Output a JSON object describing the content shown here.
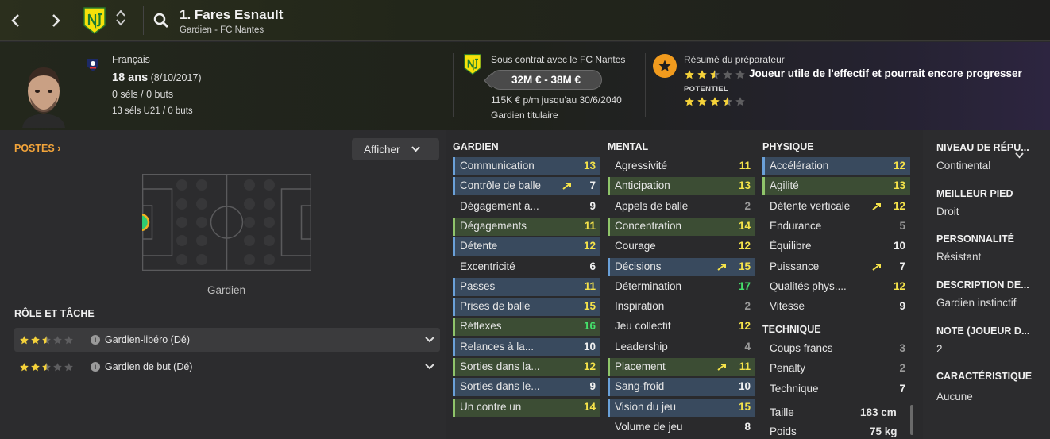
{
  "header": {
    "back_icon": "chevron-left-icon",
    "forward_icon": "chevron-right-icon",
    "player_name": "1. Fares Esnault",
    "subtitle": "Gardien - FC Nantes",
    "club_crest_color": "#f6e10a"
  },
  "info": {
    "nationality": "Français",
    "age": "18 ans",
    "birthdate": "(8/10/2017)",
    "caps": "0 séls / 0 buts",
    "caps_u21": "13 séls U21 / 0 buts",
    "contract_line": "Sous contrat avec le FC Nantes",
    "value_range": "32M € - 38M €",
    "wage": "115K € p/m jusqu'au 30/6/2040",
    "squad_status": "Gardien titulaire",
    "coach_title": "Résumé du préparateur",
    "coach_summary": "Joueur utile de l'effectif et pourrait encore progresser",
    "potential_label": "POTENTIEL",
    "current_stars": 2.5,
    "potential_stars": 3.5
  },
  "left": {
    "postes_label": "POSTES",
    "afficher_label": "Afficher",
    "position_caption": "Gardien",
    "role_title": "RÔLE ET TÂCHE",
    "roles": [
      {
        "stars": 2.5,
        "label": "Gardien-libéro (Dé)"
      },
      {
        "stars": 2.5,
        "label": "Gardien de but (Dé)"
      }
    ]
  },
  "attributes": {
    "gardien_title": "GARDIEN",
    "mental_title": "MENTAL",
    "physique_title": "PHYSIQUE",
    "technique_title": "TECHNIQUE",
    "gardien": [
      {
        "name": "Communication",
        "value": "13",
        "hl": "blue",
        "color": "y"
      },
      {
        "name": "Contrôle de balle",
        "value": "7",
        "hl": "blue",
        "color": "w",
        "arrow": true
      },
      {
        "name": "Dégagement a...",
        "value": "9",
        "hl": "",
        "color": "w"
      },
      {
        "name": "Dégagements",
        "value": "11",
        "hl": "green",
        "color": "y"
      },
      {
        "name": "Détente",
        "value": "12",
        "hl": "blue",
        "color": "y"
      },
      {
        "name": "Excentricité",
        "value": "6",
        "hl": "",
        "color": "w"
      },
      {
        "name": "Passes",
        "value": "11",
        "hl": "blue",
        "color": "y"
      },
      {
        "name": "Prises de balle",
        "value": "15",
        "hl": "blue",
        "color": "y"
      },
      {
        "name": "Réflexes",
        "value": "16",
        "hl": "green",
        "color": "g"
      },
      {
        "name": "Relances à la...",
        "value": "10",
        "hl": "blue",
        "color": "w"
      },
      {
        "name": "Sorties dans la...",
        "value": "12",
        "hl": "green",
        "color": "y"
      },
      {
        "name": "Sorties dans le...",
        "value": "9",
        "hl": "blue",
        "color": "w"
      },
      {
        "name": "Un contre un",
        "value": "14",
        "hl": "green",
        "color": "y"
      }
    ],
    "mental": [
      {
        "name": "Agressivité",
        "value": "11",
        "hl": "",
        "color": "y"
      },
      {
        "name": "Anticipation",
        "value": "13",
        "hl": "green",
        "color": "y"
      },
      {
        "name": "Appels de balle",
        "value": "2",
        "hl": "",
        "color": "gr"
      },
      {
        "name": "Concentration",
        "value": "14",
        "hl": "green",
        "color": "y"
      },
      {
        "name": "Courage",
        "value": "12",
        "hl": "",
        "color": "y"
      },
      {
        "name": "Décisions",
        "value": "15",
        "hl": "blue",
        "color": "y",
        "arrow": true
      },
      {
        "name": "Détermination",
        "value": "17",
        "hl": "",
        "color": "g"
      },
      {
        "name": "Inspiration",
        "value": "2",
        "hl": "",
        "color": "gr"
      },
      {
        "name": "Jeu collectif",
        "value": "12",
        "hl": "",
        "color": "y"
      },
      {
        "name": "Leadership",
        "value": "4",
        "hl": "",
        "color": "gr"
      },
      {
        "name": "Placement",
        "value": "11",
        "hl": "green",
        "color": "y",
        "arrow": true
      },
      {
        "name": "Sang-froid",
        "value": "10",
        "hl": "blue",
        "color": "w"
      },
      {
        "name": "Vision du jeu",
        "value": "15",
        "hl": "blue",
        "color": "y"
      },
      {
        "name": "Volume de jeu",
        "value": "8",
        "hl": "",
        "color": "w"
      }
    ],
    "physique": [
      {
        "name": "Accélération",
        "value": "12",
        "hl": "blue",
        "color": "y"
      },
      {
        "name": "Agilité",
        "value": "13",
        "hl": "green",
        "color": "y"
      },
      {
        "name": "Détente verticale",
        "value": "12",
        "hl": "",
        "color": "y",
        "arrow": true
      },
      {
        "name": "Endurance",
        "value": "5",
        "hl": "",
        "color": "gr"
      },
      {
        "name": "Équilibre",
        "value": "10",
        "hl": "",
        "color": "w"
      },
      {
        "name": "Puissance",
        "value": "7",
        "hl": "",
        "color": "w",
        "arrow": true
      },
      {
        "name": "Qualités phys....",
        "value": "12",
        "hl": "",
        "color": "y"
      },
      {
        "name": "Vitesse",
        "value": "9",
        "hl": "",
        "color": "w"
      }
    ],
    "technique": [
      {
        "name": "Coups francs",
        "value": "3",
        "hl": "",
        "color": "gr"
      },
      {
        "name": "Penalty",
        "value": "2",
        "hl": "",
        "color": "gr"
      },
      {
        "name": "Technique",
        "value": "7",
        "hl": "",
        "color": "w"
      }
    ],
    "height_label": "Taille",
    "height_value": "183 cm",
    "weight_label": "Poids",
    "weight_value": "75 kg"
  },
  "right": {
    "items": [
      {
        "title": "NIVEAU DE RÉPU...",
        "value": "Continental"
      },
      {
        "title": "MEILLEUR PIED",
        "value": "Droit"
      },
      {
        "title": "PERSONNALITÉ",
        "value": "Résistant"
      },
      {
        "title": "DESCRIPTION DE...",
        "value": "Gardien instinctif"
      },
      {
        "title": "NOTE (JOUEUR D...",
        "value": "2"
      },
      {
        "title": "CARACTÉRISTIQUE",
        "value": "Aucune"
      }
    ]
  }
}
